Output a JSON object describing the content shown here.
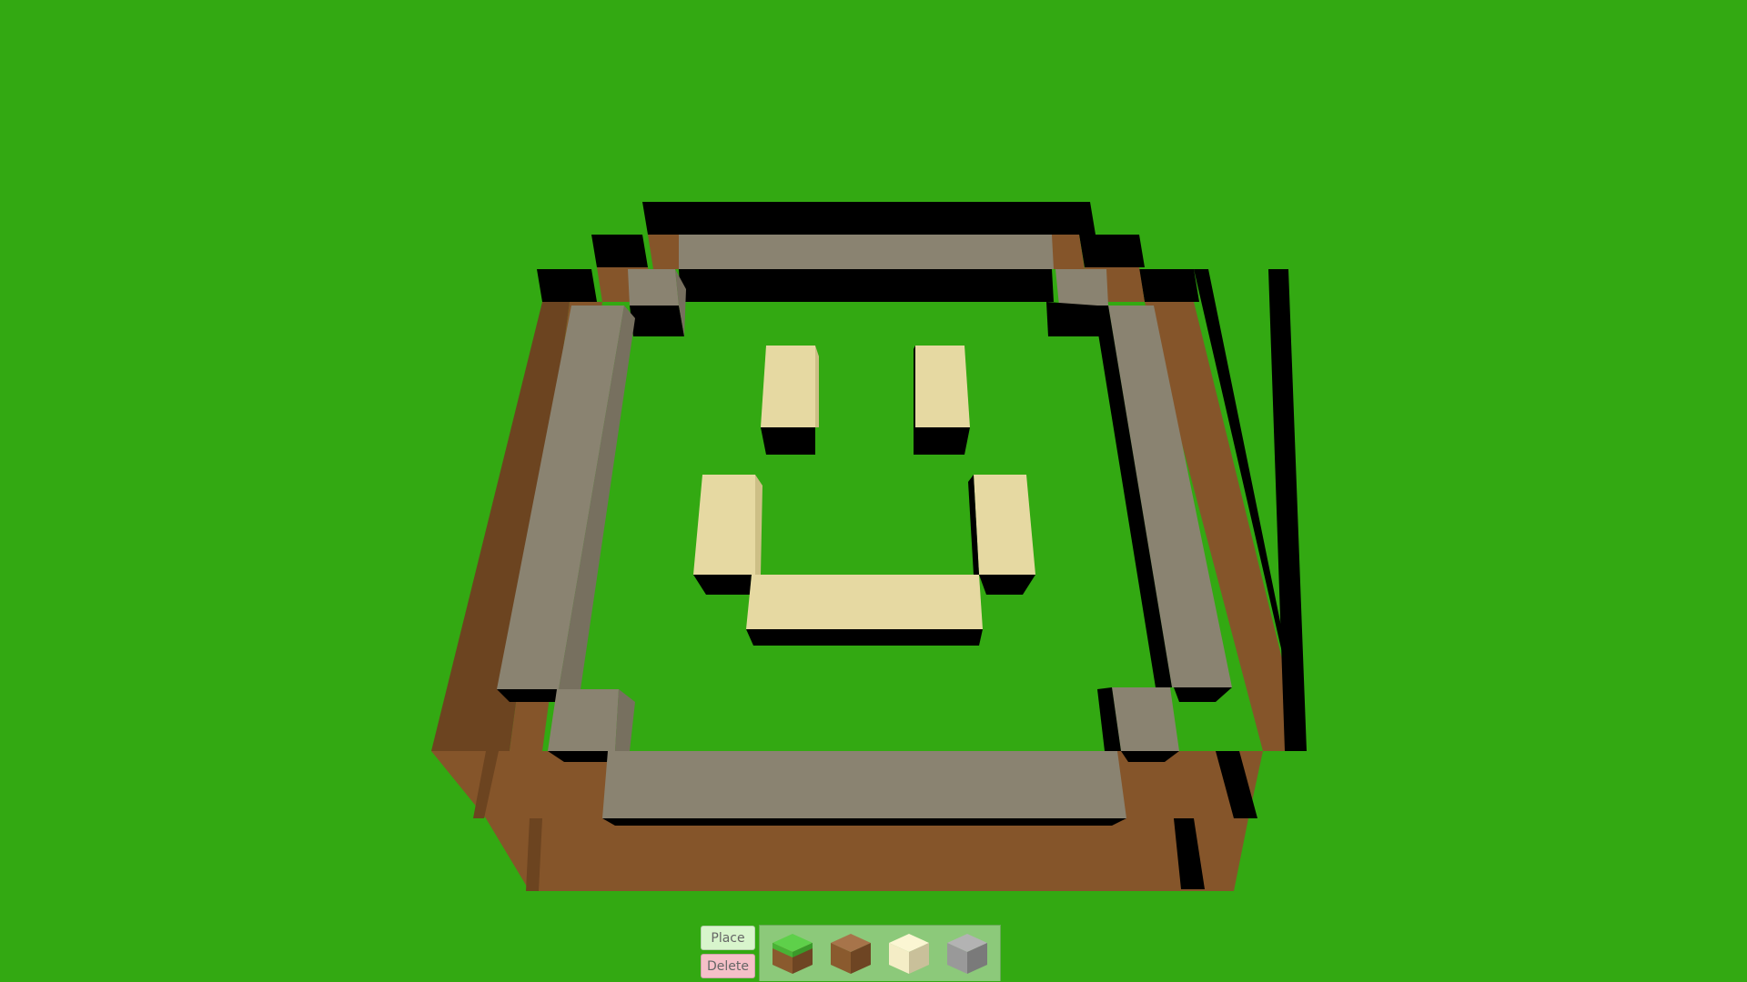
{
  "scene": {
    "background_color": "#33a912",
    "colors": {
      "dirt": "#85552a",
      "dirt_dark": "#6c4420",
      "stone": "#8a8371",
      "stone_side": "#77705f",
      "sand": "#e6d9a2",
      "sand_side": "#cdbf86",
      "shadow": "#000000"
    }
  },
  "toolbar": {
    "place_label": "Place",
    "delete_label": "Delete",
    "place_color": "#d8f5cc",
    "delete_color": "#f5c0c8",
    "blocks": [
      {
        "name": "grass-block-icon"
      },
      {
        "name": "dirt-block-icon"
      },
      {
        "name": "sand-block-icon"
      },
      {
        "name": "stone-block-icon"
      }
    ]
  }
}
